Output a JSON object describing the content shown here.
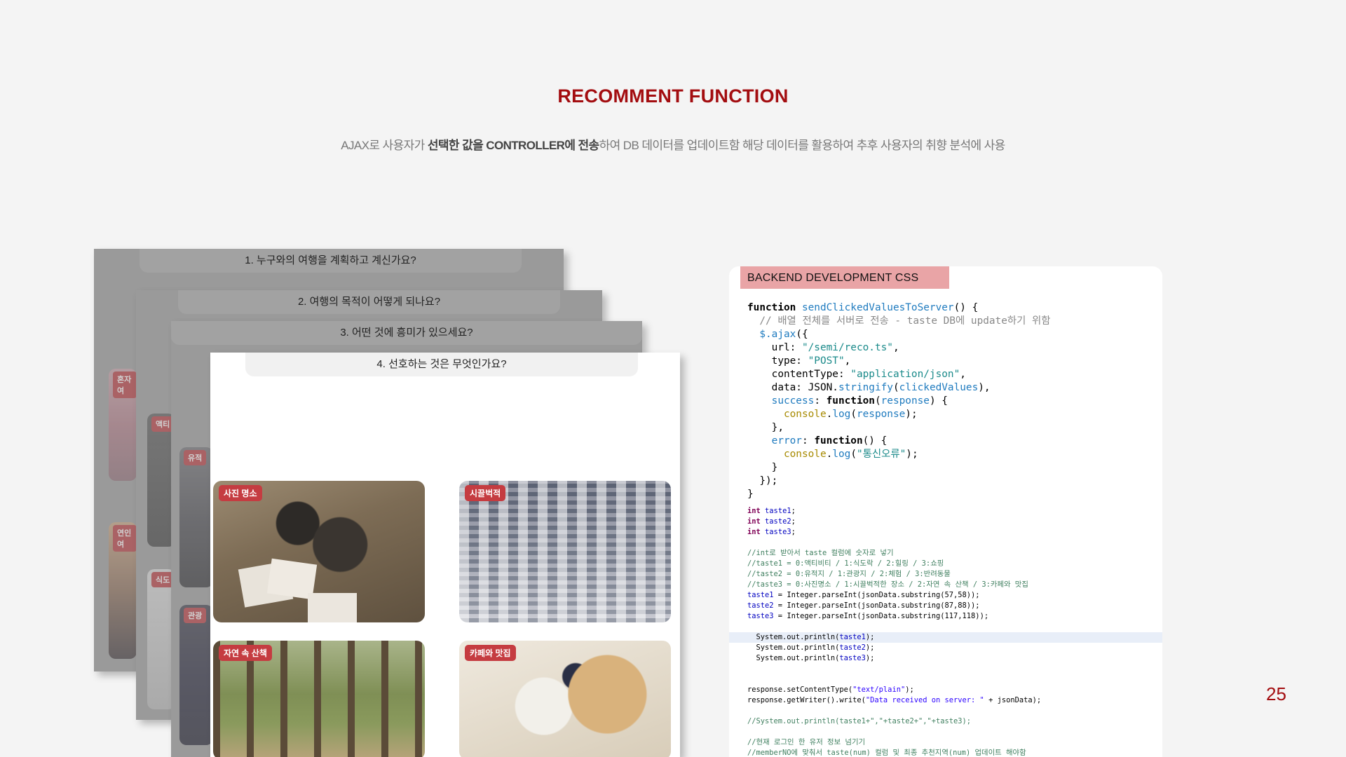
{
  "slide": {
    "title": "RECOMMENT FUNCTION",
    "subtitle_pre": "AJAX로 사용자가 ",
    "subtitle_bold": "선택한 값을 CONTROLLER에 전송",
    "subtitle_post": "하여 DB 데이터를 업데이트함 해당 데이터를 활용하여 추후 사용자의 취향 분석에 사용",
    "page_number": "25",
    "accent_color": "#a30d10"
  },
  "survey": {
    "q1": "1. 누구와의 여행을 계획하고 계신가요?",
    "q2": "2. 여행의 목적이 어떻게 되나요?",
    "q3": "3. 어떤 것에 흥미가 있으세요?",
    "q4": "4. 선호하는 것은 무엇인가요?",
    "partial_tags": [
      "혼자여",
      "연인여",
      "액티",
      "식도",
      "유적",
      "관광"
    ],
    "options": [
      "사진 명소",
      "시끌벅적",
      "자연 속 산책",
      "카페와 맛집"
    ]
  },
  "code": {
    "header": "BACKEND DEVELOPMENT  CSS",
    "js": [
      "function sendClickedValuesToServer() {",
      "  // 배열 전체를 서버로 전송 - taste DB에 update하기 위함",
      "  $.ajax({",
      "    url: \"/semi/reco.ts\",",
      "    type: \"POST\",",
      "    contentType: \"application/json\",",
      "    data: JSON.stringify(clickedValues),",
      "    success: function(response) {",
      "      console.log(response);",
      "    },",
      "    error: function() {",
      "      console.log(\"통신오류\");",
      "    }",
      "  });",
      "}"
    ],
    "java": [
      "int taste1;",
      "int taste2;",
      "int taste3;",
      "",
      "//int로 받아서 taste 컬럼에 숫자로 넣기",
      "//taste1 = 0:액티비티 / 1:식도락 / 2:힐링 / 3:쇼핑",
      "//taste2 = 0:유적지 / 1:관광지 / 2:체험 / 3:반려동물",
      "//taste3 = 0:사진명소 / 1:시끌벅적한 장소 / 2:자연 속 산책 / 3:카페와 맛집",
      "taste1 = Integer.parseInt(jsonData.substring(57,58));",
      "taste2 = Integer.parseInt(jsonData.substring(87,88));",
      "taste3 = Integer.parseInt(jsonData.substring(117,118));",
      "",
      "  System.out.println(taste1);",
      "  System.out.println(taste2);",
      "  System.out.println(taste3);",
      "",
      "",
      "response.setContentType(\"text/plain\");",
      "response.getWriter().write(\"Data received on server: \" + jsonData);",
      "",
      "//System.out.println(taste1+\",\"+taste2+\",\"+taste3);",
      "",
      "//현재 로그인 한 유저 정보 넘기기",
      "//memberNO에 맞춰서 taste(num) 컬럼 및 최종 추천지역(num) 업데이트 해야함"
    ]
  }
}
